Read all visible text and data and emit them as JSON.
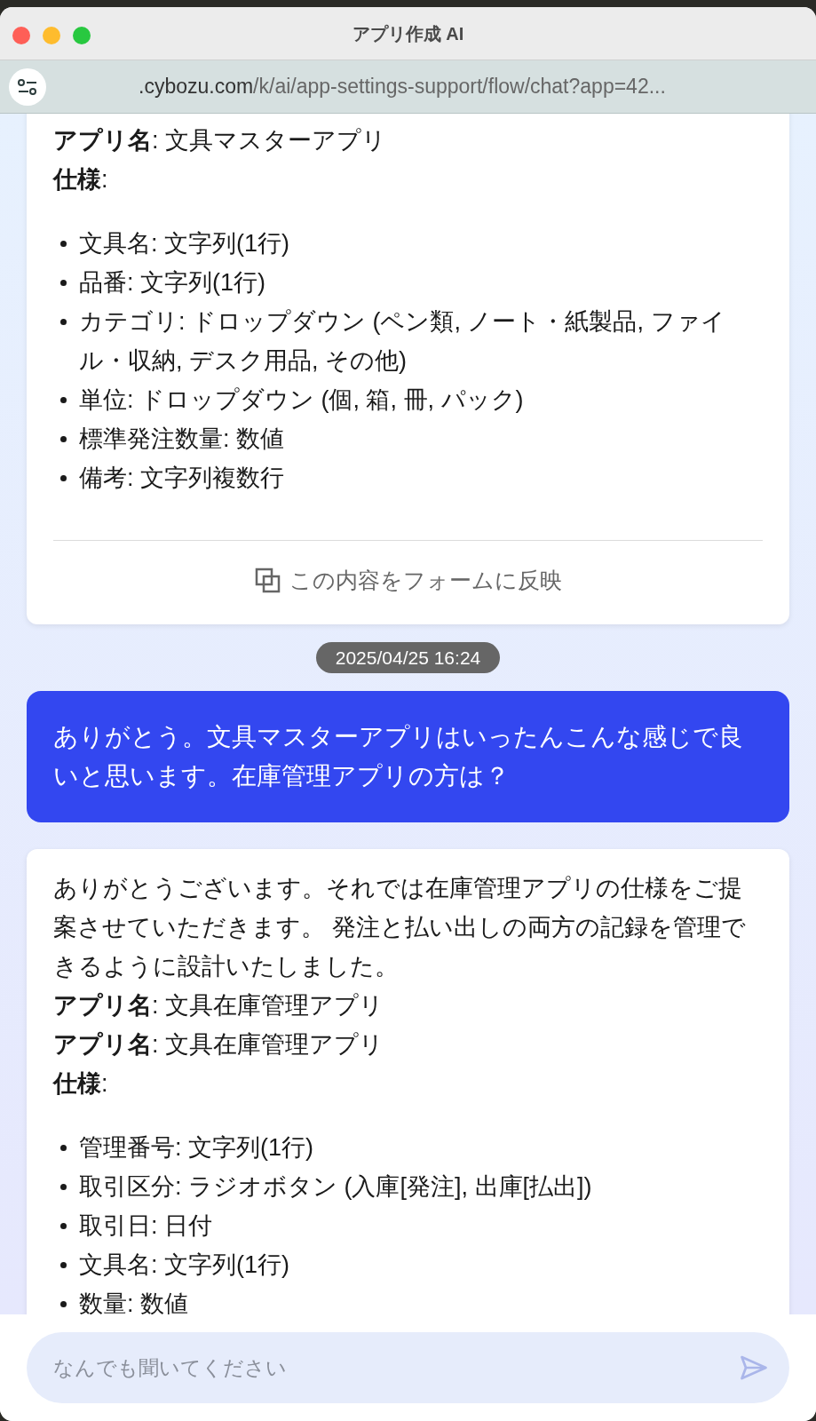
{
  "window": {
    "title": "アプリ作成 AI"
  },
  "address_bar": {
    "host": ".cybozu.com",
    "path": "/k/ai/app-settings-support/flow/chat?app=42..."
  },
  "messages": [
    {
      "kind": "ai",
      "blocks": [
        {
          "kind": "line",
          "text": "**アプリ名**: 文具マスターアプリ"
        },
        {
          "kind": "line",
          "text": "**仕様**:"
        },
        {
          "kind": "list",
          "items": [
            "文具名: 文字列(1行)",
            "品番: 文字列(1行)",
            "カテゴリ: ドロップダウン (ペン類, ノート・紙製品, ファイル・収納, デスク用品, その他)",
            "単位: ドロップダウン (個, 箱, 冊, パック)",
            "標準発注数量: 数値",
            "備考: 文字列複数行"
          ]
        }
      ],
      "action": "この内容をフォームに反映"
    },
    {
      "kind": "timestamp",
      "text": "2025/04/25 16:24"
    },
    {
      "kind": "user",
      "text": "ありがとう。文具マスターアプリはいったんこんな感じで良いと思います。在庫管理アプリの方は？"
    },
    {
      "kind": "ai",
      "blocks": [
        {
          "kind": "line",
          "text": "ありがとうございます。それでは在庫管理アプリの仕様をご提案させていただきます。 発注と払い出しの両方の記録を管理できるように設計いたしました。"
        },
        {
          "kind": "line",
          "text": "**アプリ名**: 文具在庫管理アプリ"
        },
        {
          "kind": "line",
          "text": "**アプリ名**: 文具在庫管理アプリ"
        },
        {
          "kind": "line",
          "text": "**仕様**:"
        },
        {
          "kind": "list",
          "items": [
            "管理番号: 文字列(1行)",
            "取引区分: ラジオボタン (入庫[発注], 出庫[払出])",
            "取引日: 日付",
            "文具名: 文字列(1行)",
            "数量: 数値"
          ]
        }
      ]
    }
  ],
  "composer": {
    "placeholder": "なんでも聞いてください"
  }
}
